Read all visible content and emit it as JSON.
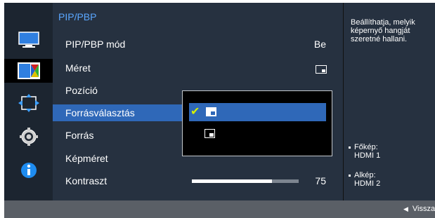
{
  "panel": {
    "title": "PIP/PBP",
    "rows": [
      {
        "label": "PIP/PBP mód",
        "value": "Be"
      },
      {
        "label": "Méret",
        "value": ""
      },
      {
        "label": "Pozíció",
        "value": ""
      },
      {
        "label": "Forrásválasztás",
        "value": ""
      },
      {
        "label": "Forrás",
        "value": ""
      },
      {
        "label": "Képméret",
        "value": ""
      },
      {
        "label": "Kontraszt",
        "value": "75",
        "progress": 0.75
      }
    ]
  },
  "info": {
    "description": "Beállíthatja, melyik képernyő hangját szeretné hallani.",
    "items": [
      {
        "line1": "Főkép:",
        "line2": "HDMI 1"
      },
      {
        "line1": "Alkép:",
        "line2": "HDMI 2"
      }
    ]
  },
  "footer": {
    "back": "Vissza"
  },
  "icons": [
    "monitor-icon",
    "color-icon",
    "move-icon",
    "gear-icon",
    "info-icon"
  ],
  "colors": {
    "accent": "#2f68b8",
    "title": "#5aa7ff",
    "check": "#d6f000"
  }
}
